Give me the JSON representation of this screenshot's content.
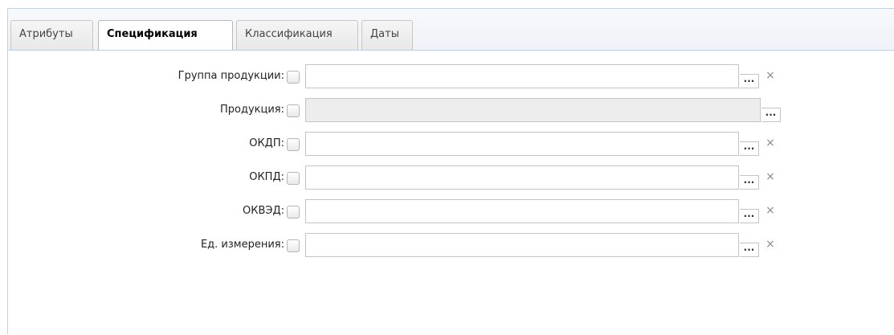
{
  "tabs": [
    {
      "label": "Атрибуты",
      "active": false
    },
    {
      "label": "Спецификация",
      "active": true
    },
    {
      "label": "Классификация",
      "active": false
    },
    {
      "label": "Даты",
      "active": false
    }
  ],
  "form": {
    "fields": [
      {
        "label": "Группа продукции:",
        "value": "",
        "checked": false,
        "disabled": false,
        "pick_icon": "ellipsis-icon",
        "clear_icon": "clear-x-icon"
      },
      {
        "label": "Продукция:",
        "value": "",
        "checked": false,
        "disabled": true,
        "pick_icon": "ellipsis-icon"
      },
      {
        "label": "ОКДП:",
        "value": "",
        "checked": false,
        "disabled": false,
        "pick_icon": "ellipsis-icon",
        "clear_icon": "clear-x-icon"
      },
      {
        "label": "ОКПД:",
        "value": "",
        "checked": false,
        "disabled": false,
        "pick_icon": "ellipsis-icon",
        "clear_icon": "clear-x-icon"
      },
      {
        "label": "ОКВЭД:",
        "value": "",
        "checked": false,
        "disabled": false,
        "pick_icon": "ellipsis-icon",
        "clear_icon": "clear-x-icon"
      },
      {
        "label": "Ед. измерения:",
        "value": "",
        "checked": false,
        "disabled": false,
        "pick_icon": "ellipsis-icon",
        "clear_icon": "clear-x-icon"
      }
    ]
  },
  "glyphs": {
    "pick": "...",
    "clear": "×"
  },
  "colors": {
    "border": "#c4c4c4",
    "disabled_field": "#ededed",
    "tab_border": "#c5c5c5",
    "panel_border": "#c2d0e0"
  }
}
